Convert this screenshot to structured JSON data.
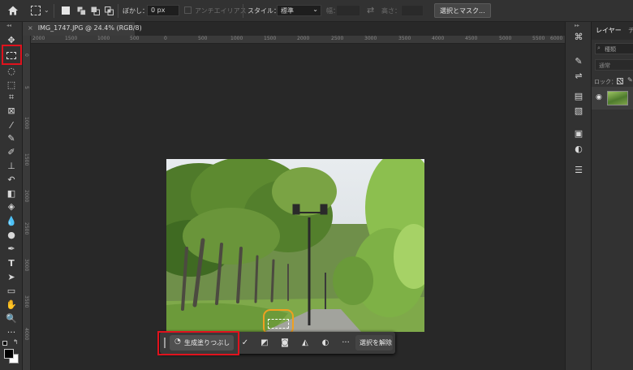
{
  "options_bar": {
    "feather_label": "ぼかし：",
    "feather_value": "0 px",
    "antialias_label": "アンチエイリアス",
    "style_label": "スタイル：",
    "style_value": "標準",
    "width_label": "幅：",
    "height_label": "高さ：",
    "select_mask_button": "選択とマスク..."
  },
  "document_tab": {
    "title": "IMG_1747.JPG @ 24.4% (RGB/8)"
  },
  "ruler_top_ticks": [
    "2000",
    "1500",
    "1000",
    "500",
    "0",
    "500",
    "1000",
    "1500",
    "2000",
    "2500",
    "3000",
    "3500",
    "4000",
    "4500",
    "5000",
    "5500",
    "6000"
  ],
  "ruler_left_ticks": [
    "0",
    "5",
    "1000",
    "1500",
    "2000",
    "2500",
    "3000",
    "3500",
    "4000"
  ],
  "layers_panel": {
    "tab_label": "レイヤー",
    "tab2_label": "チ",
    "search_placeholder": "種類",
    "blend_mode": "通常",
    "lock_label": "ロック："
  },
  "context_taskbar": {
    "generative_fill_label": "生成塗りつぶし",
    "deselect_label": "選択を解除"
  },
  "colors": {
    "highlight_red": "#e0121d",
    "highlight_orange": "#f0a020",
    "accent": "#1473e6"
  }
}
